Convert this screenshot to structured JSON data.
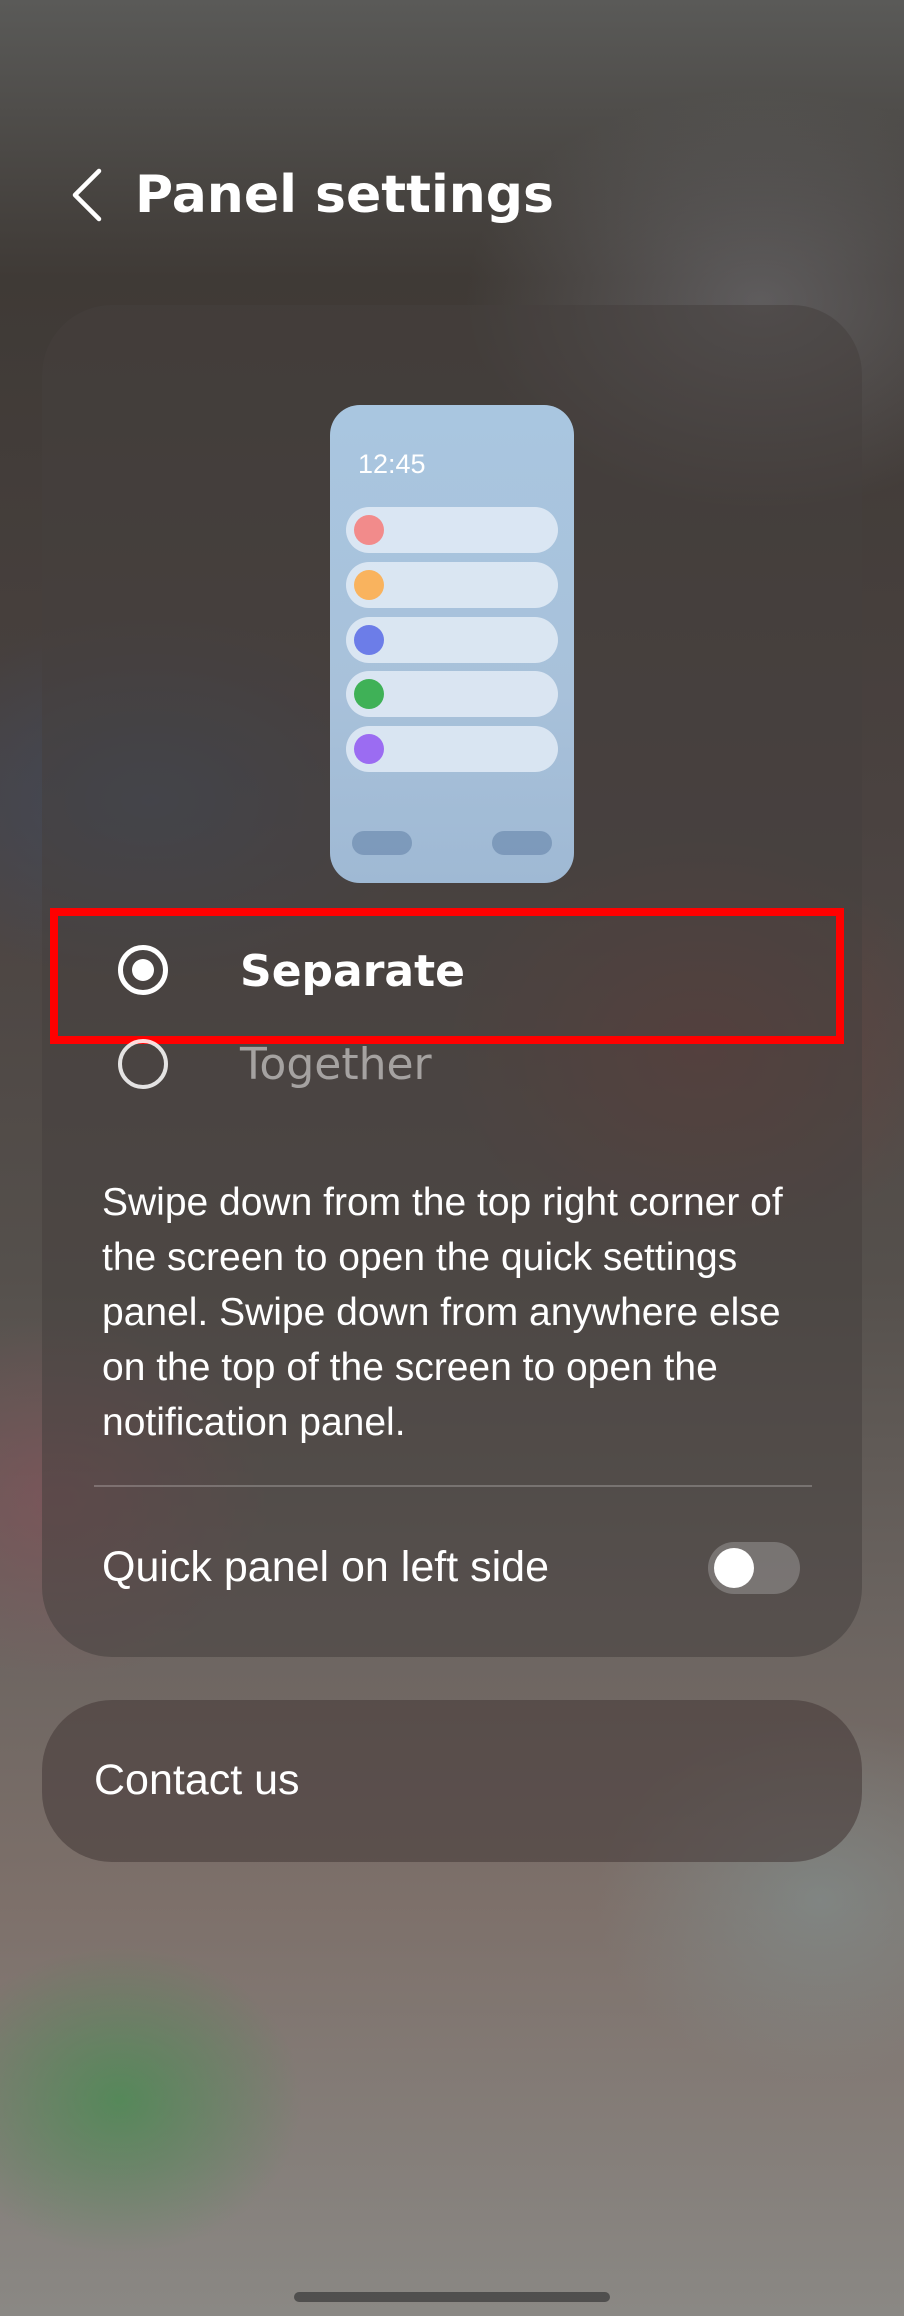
{
  "header": {
    "title": "Panel settings",
    "back_icon": "chevron-left-icon"
  },
  "preview": {
    "time": "12:45",
    "dot_colors": [
      "#f28b8b",
      "#f9b35e",
      "#6c7de8",
      "#3fb157",
      "#9b6cf2"
    ]
  },
  "options": {
    "separate": {
      "label": "Separate",
      "selected": true
    },
    "together": {
      "label": "Together",
      "selected": false
    }
  },
  "description": "Swipe down from the top right corner of the screen to open the quick settings panel. Swipe down from anywhere else on the top of the screen to open the notification panel.",
  "quick_panel": {
    "label": "Quick panel on left side",
    "enabled": false
  },
  "contact": {
    "label": "Contact us"
  },
  "colors": {
    "highlight": "#ff0000",
    "text": "#ffffff"
  }
}
